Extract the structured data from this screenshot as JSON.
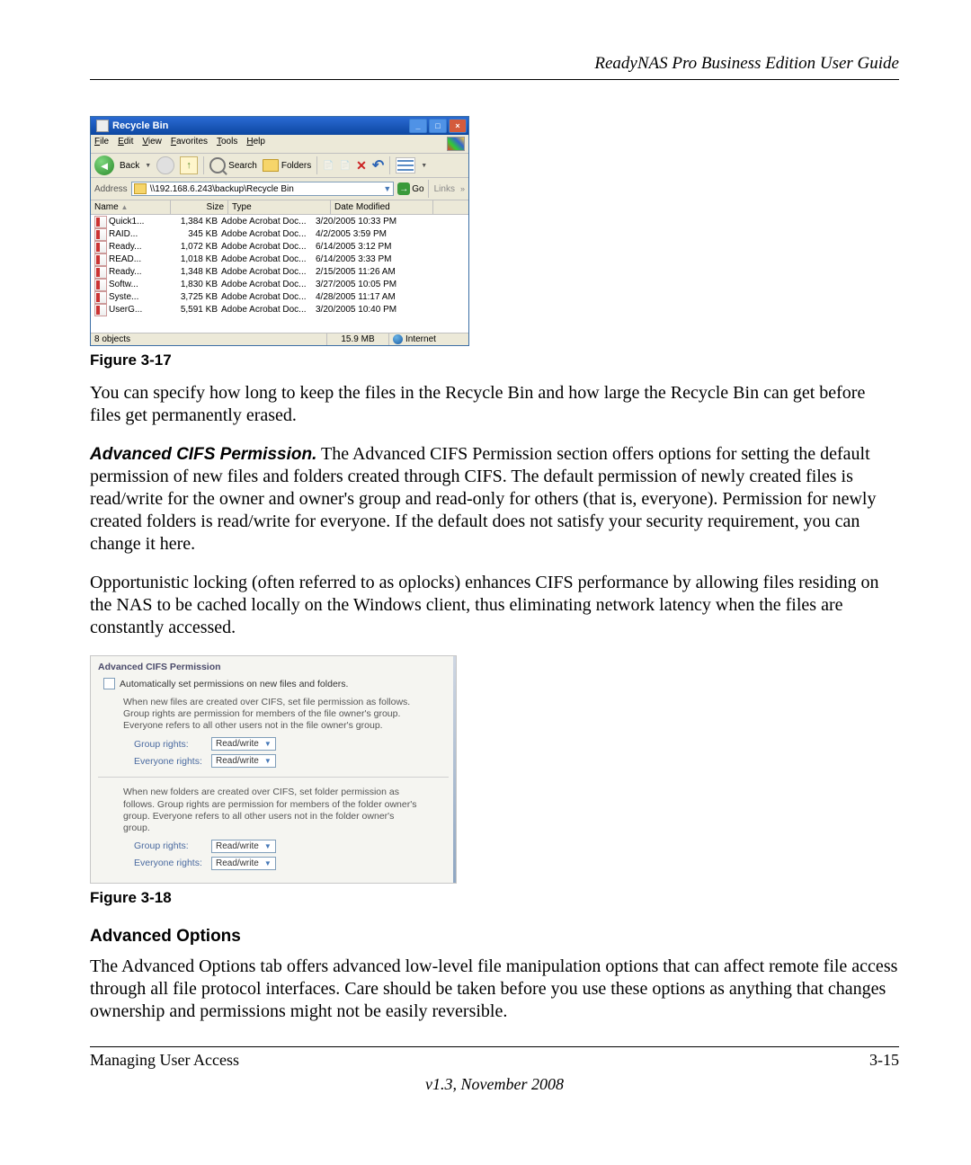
{
  "header": {
    "title": "ReadyNAS Pro Business Edition User Guide"
  },
  "fig17": {
    "win_title": "Recycle Bin",
    "menu": {
      "file": "File",
      "edit": "Edit",
      "view": "View",
      "favorites": "Favorites",
      "tools": "Tools",
      "help": "Help"
    },
    "toolbar": {
      "back": "Back",
      "search": "Search",
      "folders": "Folders"
    },
    "address": {
      "label": "Address",
      "value": "\\\\192.168.6.243\\backup\\Recycle Bin",
      "go": "Go",
      "links": "Links"
    },
    "cols": {
      "name": "Name",
      "size": "Size",
      "type": "Type",
      "date": "Date Modified"
    },
    "rows": [
      {
        "n": "Quick1...",
        "s": "1,384 KB",
        "t": "Adobe Acrobat Doc...",
        "d": "3/20/2005 10:33 PM"
      },
      {
        "n": "RAID...",
        "s": "345 KB",
        "t": "Adobe Acrobat Doc...",
        "d": "4/2/2005 3:59 PM"
      },
      {
        "n": "Ready...",
        "s": "1,072 KB",
        "t": "Adobe Acrobat Doc...",
        "d": "6/14/2005 3:12 PM"
      },
      {
        "n": "READ...",
        "s": "1,018 KB",
        "t": "Adobe Acrobat Doc...",
        "d": "6/14/2005 3:33 PM"
      },
      {
        "n": "Ready...",
        "s": "1,348 KB",
        "t": "Adobe Acrobat Doc...",
        "d": "2/15/2005 11:26 AM"
      },
      {
        "n": "Softw...",
        "s": "1,830 KB",
        "t": "Adobe Acrobat Doc...",
        "d": "3/27/2005 10:05 PM"
      },
      {
        "n": "Syste...",
        "s": "3,725 KB",
        "t": "Adobe Acrobat Doc...",
        "d": "4/28/2005 11:17 AM"
      },
      {
        "n": "UserG...",
        "s": "5,591 KB",
        "t": "Adobe Acrobat Doc...",
        "d": "3/20/2005 10:40 PM"
      }
    ],
    "status": {
      "objects": "8 objects",
      "size": "15.9 MB",
      "zone": "Internet"
    },
    "caption": "Figure 3-17"
  },
  "p1": "You can specify how long to keep the files in the Recycle Bin and how large the Recycle Bin can get before files get permanently erased.",
  "p2_head": "Advanced CIFS Permission.",
  "p2": " The Advanced CIFS Permission section offers options for setting the default permission of new files and folders created through CIFS. The default permission of newly created files is read/write for the owner and owner's group and read-only for others (that is, everyone). Permission for newly created folders is read/write for everyone. If the default does not satisfy your security requirement, you can change it here.",
  "p3": "Opportunistic locking (often referred to as oplocks) enhances CIFS performance by allowing files residing on the NAS to be cached locally on the Windows client, thus eliminating network latency when the files are constantly accessed.",
  "fig18": {
    "title": "Advanced CIFS Permission",
    "cb_label": "Automatically set permissions on new files and folders.",
    "files_desc": "When new files are created over CIFS, set file permission as follows. Group rights are permission for members of the file owner's group. Everyone refers to all other users not in the file owner's group.",
    "folders_desc": "When new folders are created over CIFS, set folder permission as follows. Group rights are permission for members of the folder owner's group. Everyone refers to all other users not in the folder owner's group.",
    "group_label": "Group rights:",
    "everyone_label": "Everyone rights:",
    "value": "Read/write",
    "caption": "Figure 3-18"
  },
  "adv_head": "Advanced Options",
  "p4": "The Advanced Options tab offers advanced low-level file manipulation options that can affect remote file access through all file protocol interfaces. Care should be taken before you use these options as anything that changes ownership and permissions might not be easily reversible.",
  "footer": {
    "left": "Managing User Access",
    "right": "3-15",
    "version": "v1.3, November 2008"
  }
}
